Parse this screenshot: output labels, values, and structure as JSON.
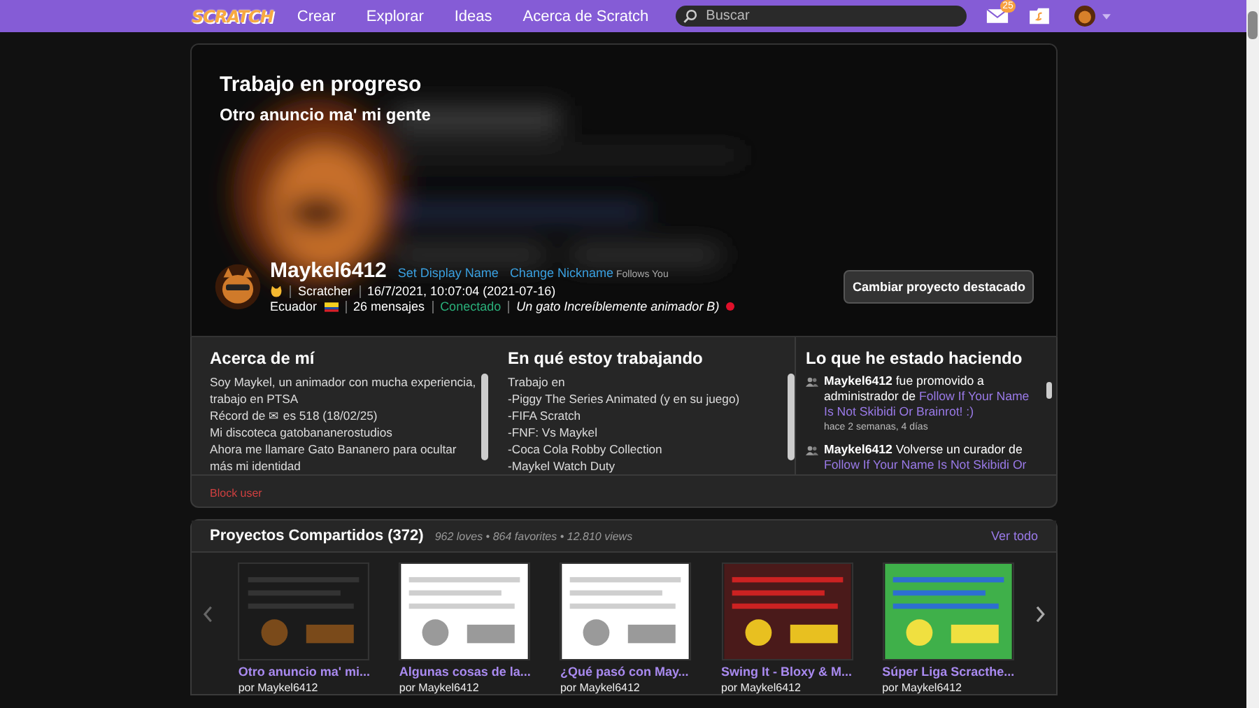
{
  "nav": {
    "logo": "SCRATCH",
    "links": [
      "Crear",
      "Explorar",
      "Ideas",
      "Acerca de Scratch"
    ],
    "search": {
      "placeholder": "Buscar"
    },
    "messages_badge": "25"
  },
  "banner": {
    "kind": "picture",
    "title": "Trabajo en progreso",
    "subtitle": "Otro anuncio ma' mi gente"
  },
  "profile": {
    "username": "Maykel6412",
    "links": [
      "Set Display Name",
      "Change Nickname"
    ],
    "follows": "Follows You",
    "role": "Scratcher",
    "joined": "16/7/2021, 10:07:04 (2021-07-16)",
    "country": "Ecuador",
    "messages": "26 mensajes",
    "status": "Conectado",
    "status_text": "Un gato Increíblemente animador B)",
    "button": "Cambiar proyecto destacado"
  },
  "about": {
    "title": "Acerca de mí",
    "lines": [
      "Soy Maykel, un animador con mucha experiencia, trabajo en PTSA",
      "Récord de ✉ es 518 (18/02/25)",
      "Mi discoteca gatobananerostudios",
      "Ahora me llamare Gato Bananero para ocultar más mi identidad"
    ]
  },
  "working": {
    "title": "En qué estoy trabajando",
    "lines": [
      "Trabajo en",
      "-Piggy The Series Animated (y en su juego)",
      "-FIFA Scratch",
      "-FNF: Vs Maykel",
      "-Coca Cola Robby Collection",
      "-Maykel Watch Duty"
    ]
  },
  "activity": {
    "title": "Lo que he estado haciendo",
    "items": [
      {
        "user": "Maykel6412",
        "action": "fue promovido a administrador de",
        "link": "Follow If Your Name Is Not Skibidi Or Brainrot! :)",
        "time": "hace 2 semanas, 4 días"
      },
      {
        "user": "Maykel6412",
        "action": "Volverse un curador de",
        "link": "Follow If Your Name Is Not Skibidi Or"
      }
    ]
  },
  "block_user": "Block user",
  "projects": {
    "title": "Proyectos Compartidos (372)",
    "stats": "962 loves • 864 favorites • 12.810 views",
    "view_all": "Ver todo",
    "items": [
      {
        "title": "Otro anuncio ma' mi...",
        "author": "por Maykel6412"
      },
      {
        "title": "Algunas cosas de la...",
        "author": "por Maykel6412"
      },
      {
        "title": "¿Qué pasó con May...",
        "author": "por Maykel6412"
      },
      {
        "title": "Swing It - Bloxy & M...",
        "author": "por Maykel6412"
      },
      {
        "title": "Súper Liga Scracthe...",
        "author": "por Maykel6412"
      }
    ]
  }
}
